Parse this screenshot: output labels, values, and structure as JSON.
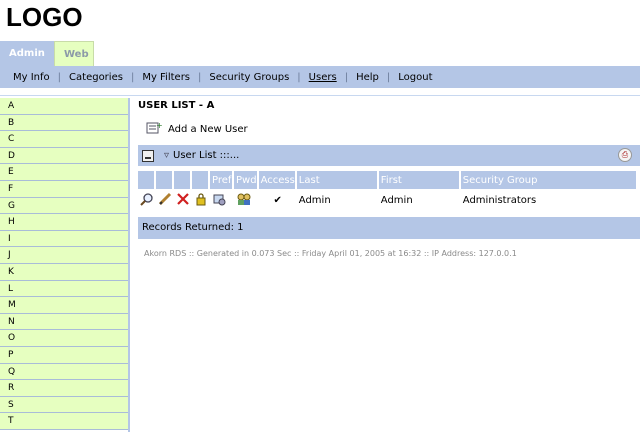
{
  "logo": "LOGO",
  "tabs": {
    "admin": "Admin",
    "web": "Web"
  },
  "menu": {
    "items": [
      "My Info",
      "Categories",
      "My Filters",
      "Security Groups",
      "Users",
      "Help",
      "Logout"
    ],
    "active": "Users"
  },
  "sidebar": {
    "letters": [
      "A",
      "B",
      "C",
      "D",
      "E",
      "F",
      "G",
      "H",
      "I",
      "J",
      "K",
      "L",
      "M",
      "N",
      "O",
      "P",
      "Q",
      "R",
      "S",
      "T"
    ]
  },
  "main": {
    "title": "USER LIST - A",
    "add_user_label": "Add a New User",
    "panel_title": "User List :::...",
    "table": {
      "headers": [
        "",
        "",
        "",
        "",
        "Pref",
        "Pwd",
        "Access",
        "Last",
        "First",
        "Security Group"
      ],
      "rows": [
        {
          "last": "Admin",
          "first": "Admin",
          "security_group": "Administrators",
          "access": "✔"
        }
      ]
    },
    "records_returned": "Records Returned: 1",
    "footer": "Akorn RDS :: Generated in 0.073 Sec :: Friday April 01, 2005 at 16:32 :: IP Address: 127.0.0.1"
  },
  "colors": {
    "accent": "#b4c6e6",
    "sidebar_bg": "#e6ffc0"
  },
  "icons": {
    "row_actions": [
      "magnifier-icon",
      "pencil-icon",
      "delete-x-icon",
      "lock-icon",
      "preferences-icon",
      "password-users-icon"
    ]
  }
}
